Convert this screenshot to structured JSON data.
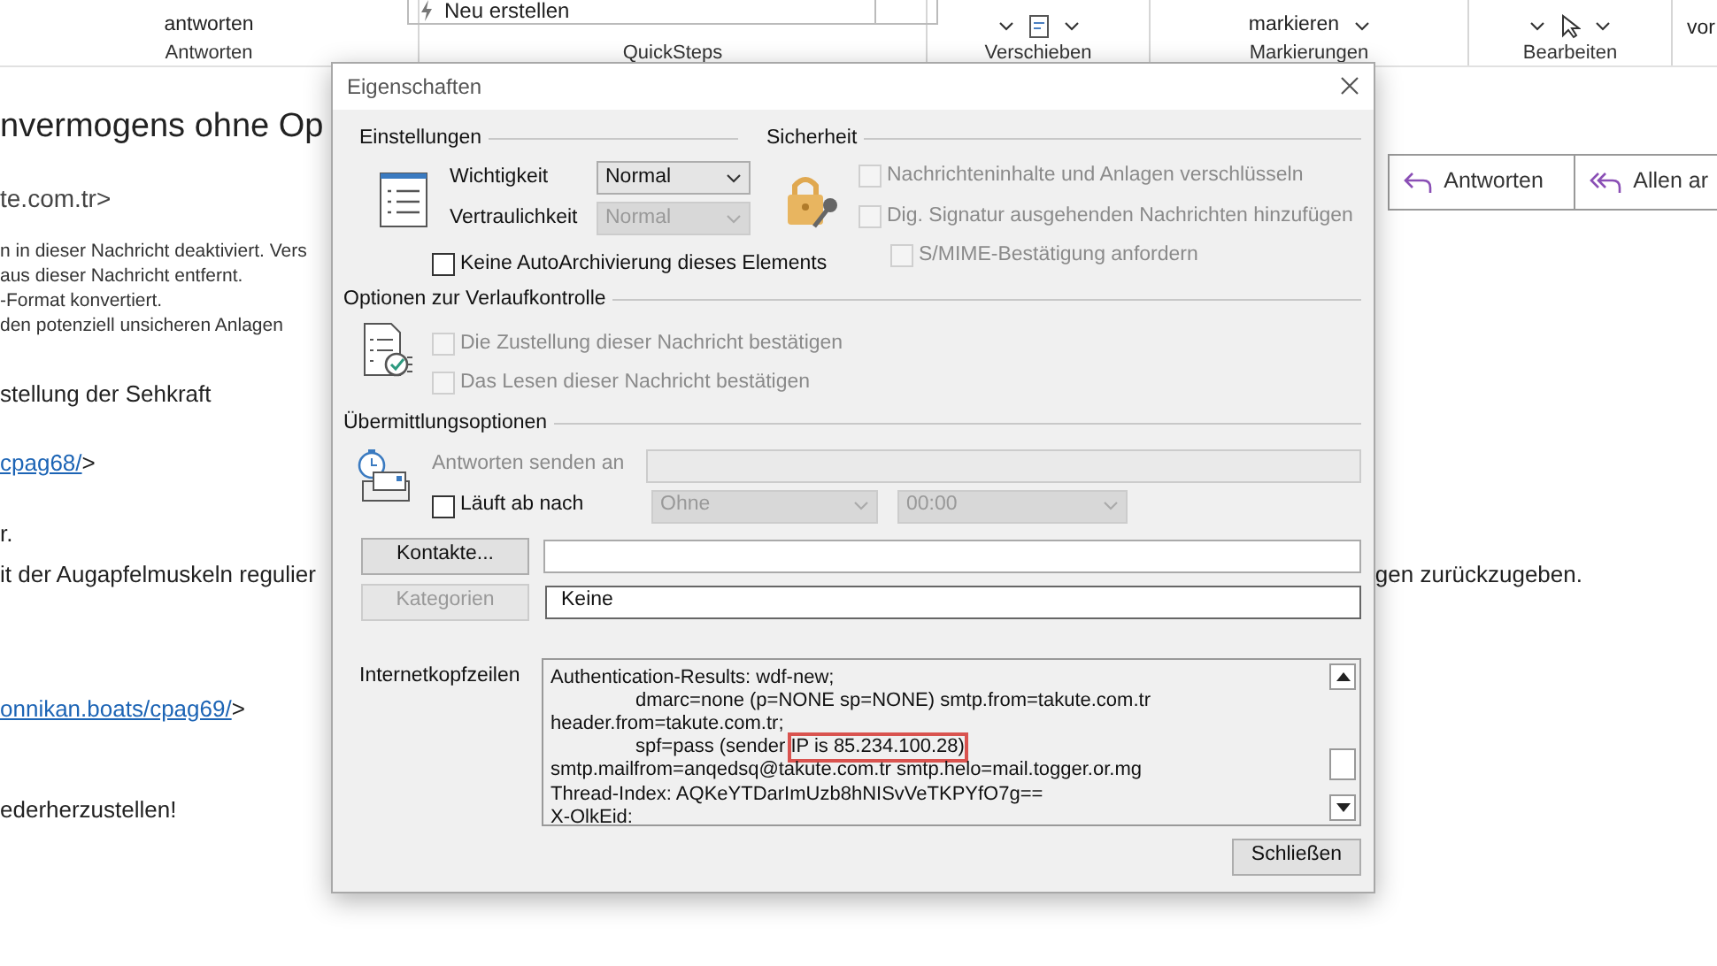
{
  "ribbon": {
    "groups": [
      {
        "label": "Antworten",
        "kind": "button",
        "text": "antworten"
      },
      {
        "label": "QuickSteps",
        "kind": "gallery",
        "text": "Neu erstellen"
      },
      {
        "label": "Verschieben",
        "kind": "icons"
      },
      {
        "label": "Markierungen",
        "kind": "button",
        "text": "markieren"
      },
      {
        "label": "Bearbeiten",
        "kind": "icons"
      }
    ],
    "overflow": "vor"
  },
  "email": {
    "subject": "nvermogens ohne Op",
    "sender": "te.com.tr>",
    "notices": [
      "n in dieser Nachricht deaktiviert. Vers",
      "aus dieser Nachricht entfernt.",
      "-Format konvertiert.",
      "den potenziell unsicheren Anlagen"
    ],
    "actions": [
      {
        "label": "Antworten",
        "kind": "reply"
      },
      {
        "label": "Allen ar",
        "kind": "reply-all"
      }
    ],
    "body": [
      {
        "kind": "text",
        "text": "stellung der Sehkraft"
      },
      {
        "kind": "link",
        "link": "cpag68/",
        "text": ">"
      },
      {
        "kind": "text",
        "text": "r."
      },
      {
        "kind": "split",
        "text": "it der Augapfelmuskeln regulier",
        "text_right": "gen zurückzugeben."
      },
      {
        "kind": "link",
        "link": "onnikan.boats/cpag69/",
        "text": ">"
      },
      {
        "kind": "text",
        "text": "ederherzustellen!"
      }
    ]
  },
  "dialog": {
    "title": "Eigenschaften",
    "settings": {
      "heading": "Einstellungen",
      "fields": [
        {
          "label": "Wichtigkeit",
          "value": "Normal",
          "disabled": false
        },
        {
          "label": "Vertraulichkeit",
          "value": "Normal",
          "disabled": true
        }
      ]
    },
    "security": {
      "heading": "Sicherheit",
      "options": [
        {
          "label": "Nachrichteninhalte und Anlagen verschlüsseln",
          "checked": false,
          "disabled": true
        },
        {
          "label": "Dig. Signatur ausgehenden Nachrichten hinzufügen",
          "checked": false,
          "disabled": true,
          "children": [
            {
              "label": "S/MIME-Bestätigung anfordern",
              "checked": false,
              "disabled": true
            }
          ]
        }
      ]
    },
    "no_autoarchive": {
      "label": "Keine AutoArchivierung dieses Elements",
      "checked": false,
      "disabled": false
    },
    "tracking": {
      "heading": "Optionen zur Verlaufkontrolle",
      "options": [
        {
          "label": "Die Zustellung dieser Nachricht bestätigen",
          "checked": false,
          "disabled": true
        },
        {
          "label": "Das Lesen dieser Nachricht bestätigen",
          "checked": false,
          "disabled": true
        }
      ]
    },
    "delivery": {
      "heading": "Übermittlungsoptionen",
      "reply_to": {
        "label": "Antworten senden an",
        "disabled": true
      },
      "expires": {
        "label": "Läuft ab nach",
        "checked": false,
        "date": "Ohne",
        "time": "00:00",
        "disabled": true
      }
    },
    "contacts": {
      "button": "Kontakte...",
      "disabled": false
    },
    "categories": {
      "button": "Kategorien",
      "disabled": true,
      "value": "Keine"
    },
    "headers": {
      "label": "Internetkopfzeilen",
      "lines": [
        {
          "kind": "plain",
          "text": "Authentication-Results: wdf-new;"
        },
        {
          "kind": "continuation",
          "text": "dmarc=none (p=NONE sp=NONE) smtp.from=takute.com.tr"
        },
        {
          "kind": "plain",
          "text": "header.from=takute.com.tr;"
        },
        {
          "kind": "continuation",
          "text": "spf=pass (sender",
          "highlight": "IP is 85.234.100.28)"
        },
        {
          "kind": "plain",
          "text": "smtp.mailfrom=anqedsq@takute.com.tr smtp.helo=mail.togger.or.mg"
        },
        {
          "kind": "plain",
          "text": "Thread-Index: AQKeYTDarImUzb8hNISvVeTKPYfO7g=="
        },
        {
          "kind": "plain",
          "text": "X-OlkEid:"
        }
      ]
    },
    "close_button": "Schließen"
  }
}
